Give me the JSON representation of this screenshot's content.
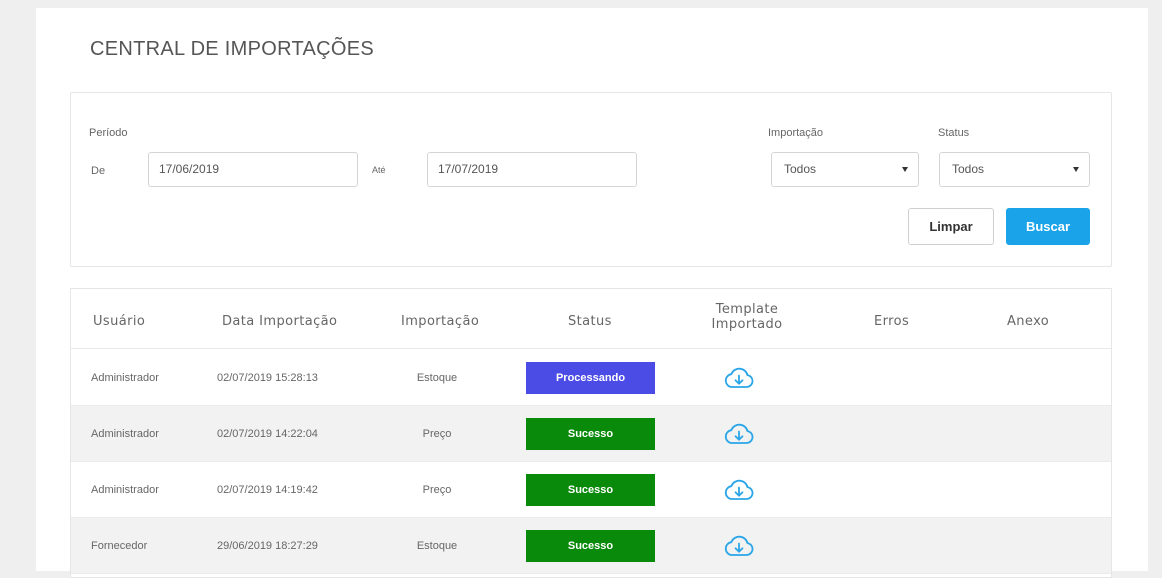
{
  "page": {
    "title": "CENTRAL DE IMPORTAÇÕES"
  },
  "filters": {
    "period_label": "Período",
    "from_label": "De",
    "from_value": "17/06/2019",
    "to_label": "Até",
    "to_value": "17/07/2019",
    "import_label": "Importação",
    "import_value": "Todos",
    "status_label": "Status",
    "status_value": "Todos",
    "clear_label": "Limpar",
    "search_label": "Buscar"
  },
  "table": {
    "headers": {
      "user": "Usuário",
      "date": "Data Importação",
      "import": "Importação",
      "status": "Status",
      "template_line1": "Template",
      "template_line2": "Importado",
      "errors": "Erros",
      "attachment": "Anexo"
    },
    "rows": [
      {
        "user": "Administrador",
        "date": "02/07/2019 15:28:13",
        "import": "Estoque",
        "status": "Processando",
        "status_color": "#4b4be6",
        "template_icon": "cloud-download-icon"
      },
      {
        "user": "Administrador",
        "date": "02/07/2019 14:22:04",
        "import": "Preço",
        "status": "Sucesso",
        "status_color": "#0a8a0a",
        "template_icon": "cloud-download-icon"
      },
      {
        "user": "Administrador",
        "date": "02/07/2019 14:19:42",
        "import": "Preço",
        "status": "Sucesso",
        "status_color": "#0a8a0a",
        "template_icon": "cloud-download-icon"
      },
      {
        "user": "Fornecedor",
        "date": "29/06/2019 18:27:29",
        "import": "Estoque",
        "status": "Sucesso",
        "status_color": "#0a8a0a",
        "template_icon": "cloud-download-icon"
      }
    ]
  },
  "colors": {
    "accent": "#1aa3e8",
    "processing": "#4b4be6",
    "success": "#0a8a0a",
    "icon": "#2aa6e6"
  }
}
